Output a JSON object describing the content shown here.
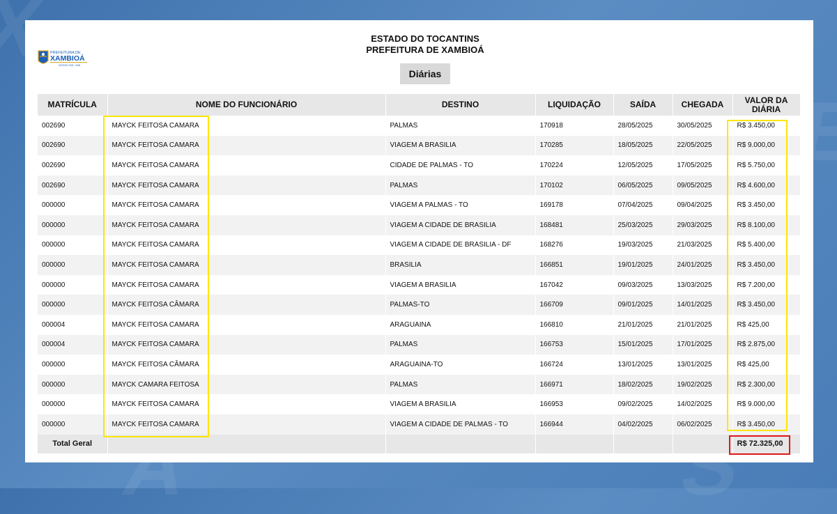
{
  "header": {
    "line1": "ESTADO DO TOCANTINS",
    "line2": "PREFEITURA DE XAMBIOÁ",
    "tag": "Diárias"
  },
  "logo": {
    "top_text": "PREFEITURA DE",
    "name": "XAMBIOÁ",
    "sub": "GESTÃO 2025 - 2028",
    "colors": {
      "blue": "#1c5fb4",
      "gold": "#d9a521"
    }
  },
  "table": {
    "columns": [
      "MATRÍCULA",
      "NOME DO FUNCIONÁRIO",
      "DESTINO",
      "LIQUIDAÇÃO",
      "SAÍDA",
      "CHEGADA",
      "VALOR DA DIÁRIA"
    ],
    "rows": [
      [
        "002690",
        "MAYCK FEITOSA CAMARA",
        "PALMAS",
        "170918",
        "28/05/2025",
        "30/05/2025",
        "R$ 3.450,00"
      ],
      [
        "002690",
        "MAYCK FEITOSA CAMARA",
        "VIAGEM A BRASILIA",
        "170285",
        "18/05/2025",
        "22/05/2025",
        "R$ 9.000,00"
      ],
      [
        "002690",
        "MAYCK FEITOSA CAMARA",
        "CIDADE DE PALMAS - TO",
        "170224",
        "12/05/2025",
        "17/05/2025",
        "R$ 5.750,00"
      ],
      [
        "002690",
        "MAYCK FEITOSA CAMARA",
        "PALMAS",
        "170102",
        "06/05/2025",
        "09/05/2025",
        "R$ 4.600,00"
      ],
      [
        "000000",
        "MAYCK FEITOSA CAMARA",
        "VIAGEM A PALMAS - TO",
        "169178",
        "07/04/2025",
        "09/04/2025",
        "R$ 3.450,00"
      ],
      [
        "000000",
        "MAYCK FEITOSA CAMARA",
        "VIAGEM A CIDADE DE BRASILIA",
        "168481",
        "25/03/2025",
        "29/03/2025",
        "R$ 8.100,00"
      ],
      [
        "000000",
        "MAYCK FEITOSA CAMARA",
        "VIAGEM A CIDADE DE BRASILIA - DF",
        "168276",
        "19/03/2025",
        "21/03/2025",
        "R$ 5.400,00"
      ],
      [
        "000000",
        "MAYCK FEITOSA CAMARA",
        "BRASILIA",
        "166851",
        "19/01/2025",
        "24/01/2025",
        "R$ 3.450,00"
      ],
      [
        "000000",
        "MAYCK FEITOSA CAMARA",
        "VIAGEM A BRASILIA",
        "167042",
        "09/03/2025",
        "13/03/2025",
        "R$ 7.200,00"
      ],
      [
        "000000",
        "MAYCK FEITOSA CÂMARA",
        "PALMAS-TO",
        "166709",
        "09/01/2025",
        "14/01/2025",
        "R$ 3.450,00"
      ],
      [
        "000004",
        "MAYCK FEITOSA CAMARA",
        "ARAGUAINA",
        "166810",
        "21/01/2025",
        "21/01/2025",
        "R$ 425,00"
      ],
      [
        "000004",
        "MAYCK FEITOSA CAMARA",
        "PALMAS",
        "166753",
        "15/01/2025",
        "17/01/2025",
        "R$ 2.875,00"
      ],
      [
        "000000",
        "MAYCK FEITOSA CÂMARA",
        "ARAGUAINA-TO",
        "166724",
        "13/01/2025",
        "13/01/2025",
        "R$ 425,00"
      ],
      [
        "000000",
        "MAYCK CAMARA FEITOSA",
        "PALMAS",
        "166971",
        "18/02/2025",
        "19/02/2025",
        "R$ 2.300,00"
      ],
      [
        "000000",
        "MAYCK FEITOSA CAMARA",
        "VIAGEM A BRASILIA",
        "166953",
        "09/02/2025",
        "14/02/2025",
        "R$ 9.000,00"
      ],
      [
        "000000",
        "MAYCK FEITOSA CAMARA",
        "VIAGEM A CIDADE DE PALMAS - TO",
        "166944",
        "04/02/2025",
        "06/02/2025",
        "R$ 3.450,00"
      ]
    ],
    "total_label": "Total Geral",
    "total_value": "R$ 72.325,00"
  },
  "highlights": {
    "names_color": "#ffe600",
    "values_color": "#ffe600",
    "total_color": "#e01818"
  }
}
